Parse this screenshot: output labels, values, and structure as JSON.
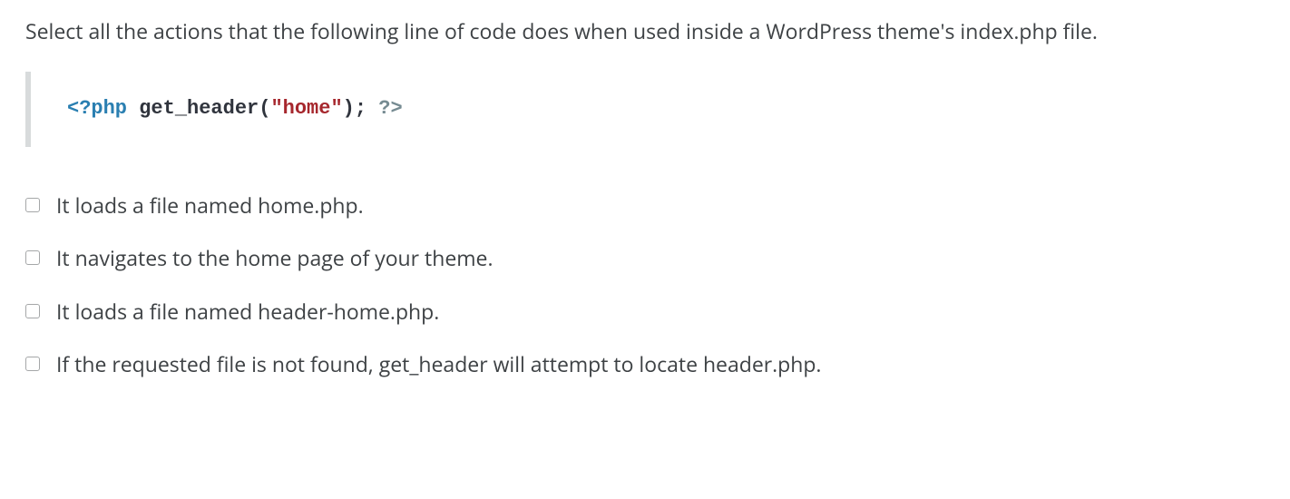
{
  "question": "Select all the actions that the following line of code does when used inside a WordPress theme's index.php file.",
  "code": {
    "open_tag": "<?php",
    "func": "get_header",
    "string": "\"home\"",
    "close_tag": "?>"
  },
  "options": [
    {
      "label": "It loads a file named home.php."
    },
    {
      "label": "It navigates to the home page of your theme."
    },
    {
      "label": "It loads a file named header-home.php."
    },
    {
      "label": "If the requested file is not found, get_header will attempt to locate header.php."
    }
  ]
}
